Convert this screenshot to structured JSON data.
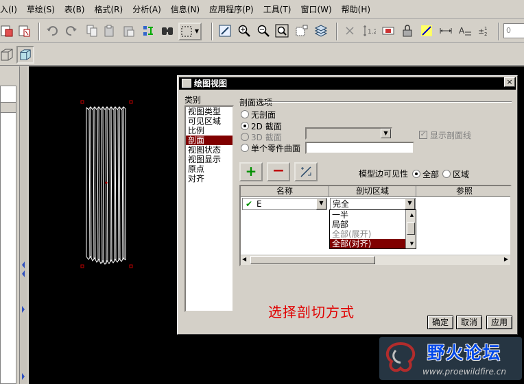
{
  "menu": [
    "入(I)",
    "草绘(S)",
    "表(B)",
    "格式(R)",
    "分析(A)",
    "信息(N)",
    "应用程序(P)",
    "工具(T)",
    "窗口(W)",
    "帮助(H)"
  ],
  "toolbar": {
    "input_value": "0"
  },
  "dialog": {
    "title": "绘图视图",
    "close_glyph": "×",
    "category_label": "类别",
    "categories": [
      "视图类型",
      "可见区域",
      "比例",
      "剖面",
      "视图状态",
      "视图显示",
      "原点",
      "对齐"
    ],
    "selected_category": "剖面",
    "section_options_label": "剖面选项",
    "opt_none": "无剖面",
    "opt_2d": "2D 截面",
    "opt_3d": "3D 截面",
    "opt_single": "单个零件曲面",
    "selected_option": "2D 截面",
    "show_hatch_label": "显示剖面线",
    "show_hatch_checked": true,
    "edge_visibility_label": "模型边可见性",
    "edge_all": "全部",
    "edge_region": "区域",
    "add_glyph": "+",
    "remove_glyph": "−",
    "table": {
      "columns": [
        "名称",
        "剖切区域",
        "参照"
      ],
      "row_name": "E",
      "row_region": "完全",
      "dropdown_options": [
        "一半",
        "局部",
        "全部(展开)",
        "全部(对齐)"
      ],
      "highlighted_option": "全部(对齐)",
      "disabled_option": "全部(展开)"
    },
    "caption": "选择剖切方式",
    "buttons": {
      "ok": "确定",
      "cancel": "取消",
      "apply": "应用"
    }
  },
  "watermark": {
    "title": "野火论坛",
    "url": "www.proewildfire.cn"
  },
  "colors": {
    "selection": "#800000",
    "caption": "#e00000",
    "canvas": "#000000",
    "dialog_bg": "#d4d0c8"
  }
}
